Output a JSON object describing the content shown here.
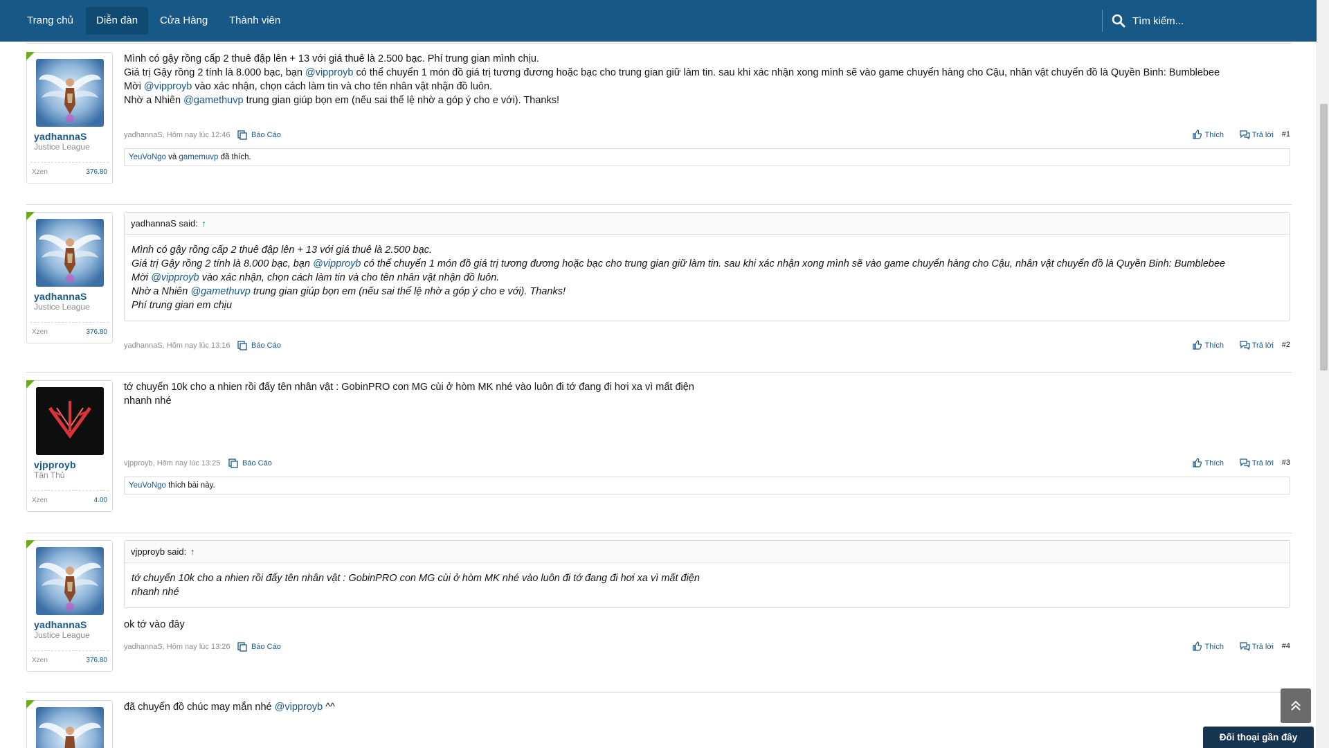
{
  "nav": {
    "tabs": [
      {
        "label": "Trang chủ"
      },
      {
        "label": "Diễn đàn"
      },
      {
        "label": "Cửa Hàng"
      },
      {
        "label": "Thành viên"
      }
    ],
    "search_placeholder": "Tìm kiếm..."
  },
  "posts": [
    {
      "author": "yadhannaS",
      "user_title": "Justice League",
      "stat_label": "Xzen",
      "stat_value": "376.80",
      "lines": [
        "Mình có gậy rồng cấp 2 thuê đập lên + 13 với giá thuê là 2.500 bạc. Phí trung gian mình chịu.",
        {
          "pre": "Giá trị Gậy rồng 2 tính là 8.000 bạc, bạn ",
          "mention": "@vipproyb",
          "post": " có thể chuyển 1 món đồ giá trị tương đương hoặc bạc cho trung gian giữ làm tin. sau khi xác nhận xong mình sẽ vào game chuyển hàng cho Cậu, nhân vật chuyển đồ là Quyền Binh: Bumblebee"
        },
        {
          "pre": "Mời ",
          "mention": "@vipproyb",
          "post": " vào xác nhận, chọn cách làm tin và cho tên nhân vật nhận đồ luôn."
        },
        {
          "pre": "Nhờ a Nhiên ",
          "mention": "@gamethuvp",
          "post": " trung gian giúp bọn em (nếu sai thể lệ nhờ a góp ý cho e với). Thanks!"
        }
      ],
      "meta": "yadhannaS, Hôm nay lúc 12:46",
      "report": "Báo Cáo",
      "like": "Thích",
      "reply": "Trả lời",
      "number": "#1",
      "likes": {
        "user1": "YeuVoNgo",
        "joiner": " và ",
        "user2": "gamemuvp",
        "suffix": " đã thích."
      }
    },
    {
      "author": "yadhannaS",
      "user_title": "Justice League",
      "stat_label": "Xzen",
      "stat_value": "376.80",
      "quote": {
        "head": "yadhannaS said:",
        "arrow": "↑",
        "lines": [
          "Mình có gậy rồng cấp 2 thuê đập lên + 13 với giá thuê là 2.500 bạc.",
          {
            "pre": "Giá trị Gậy rồng 2 tính là 8.000 bạc, bạn ",
            "mention": "@vipproyb",
            "post": " có thể chuyển 1 món đồ giá trị tương đương hoặc bạc cho trung gian giữ làm tin. sau khi xác nhận xong mình sẽ vào game chuyển hàng cho Cậu, nhân vật chuyển đồ là Quyền Binh: Bumblebee"
          },
          {
            "pre": "Mời ",
            "mention": "@vipproyb",
            "post": " vào xác nhận, chọn cách làm tin và cho tên nhân vật nhận đồ luôn."
          },
          {
            "pre": "Nhờ a Nhiên ",
            "mention": "@gamethuvp",
            "post": " trung gian giúp bọn em (nếu sai thể lệ nhờ a góp ý cho e với). Thanks!"
          },
          "Phí trung gian em chịu"
        ]
      },
      "meta": "yadhannaS, Hôm nay lúc 13:16",
      "report": "Báo Cáo",
      "like": "Thích",
      "reply": "Trả lời",
      "number": "#2"
    },
    {
      "author": "vjpproyb",
      "user_title": "Tân Thủ",
      "stat_label": "Xzen",
      "stat_value": "4.00",
      "lines": [
        "tớ chuyển 10k cho a nhien rồi đấy tên nhân vật : GobinPRO con MG cùi ở hòm MK nhé vào luôn đi tớ đang đi hơi xa vì mất điện",
        "nhanh nhé"
      ],
      "meta": "vjpproyb, Hôm nay lúc 13:25",
      "report": "Báo Cáo",
      "like": "Thích",
      "reply": "Trả lời",
      "number": "#3",
      "likes": {
        "user1": "YeuVoNgo",
        "suffix": " thích bài này."
      }
    },
    {
      "author": "yadhannaS",
      "user_title": "Justice League",
      "stat_label": "Xzen",
      "stat_value": "376.80",
      "quote": {
        "head": "vjpproyb said:",
        "arrow": "↑",
        "lines": [
          "tớ chuyển 10k cho a nhien rồi đấy tên nhân vật : GobinPRO con MG cùi ở hòm MK nhé vào luôn đi tớ đang đi hơi xa vì mất điện",
          "nhanh nhé"
        ]
      },
      "lines": [
        "ok tớ vào đây"
      ],
      "meta": "yadhannaS, Hôm nay lúc 13:26",
      "report": "Báo Cáo",
      "like": "Thích",
      "reply": "Trả lời",
      "number": "#4"
    },
    {
      "author": "",
      "lines": [
        {
          "pre": "đã chuyển đồ chúc may mắn nhé ",
          "mention": "@vipproyb",
          "post": " ^^"
        }
      ]
    }
  ],
  "floating": {
    "recent_chat": "Đối thoại gần đây"
  },
  "colors": {
    "nav_bg": "#185886",
    "link": "#185886",
    "corner_accent": "#6bab18"
  }
}
